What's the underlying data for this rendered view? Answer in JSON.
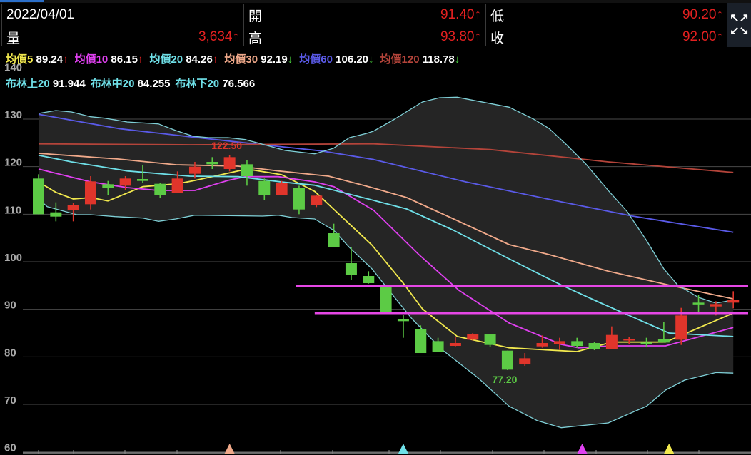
{
  "header": {
    "date": "2022/04/01",
    "open_label": "開",
    "open_value": "91.40↑",
    "low_label": "低",
    "low_value": "90.20↑",
    "volume_label": "量",
    "volume_value": "3,634↑",
    "high_label": "高",
    "high_value": "93.80↑",
    "close_label": "收",
    "close_value": "92.00↑",
    "expand_icon": "expand-arrows-icon"
  },
  "ma_legend": [
    {
      "label": "均價5",
      "value": "89.24",
      "arrow": "↑",
      "color": "#f2e94e",
      "dir": "up"
    },
    {
      "label": "均價10",
      "value": "86.15",
      "arrow": "↑",
      "color": "#e040f0",
      "dir": "up"
    },
    {
      "label": "均價20",
      "value": "84.26",
      "arrow": "↑",
      "color": "#6fe0e8",
      "dir": "up"
    },
    {
      "label": "均價30",
      "value": "92.19",
      "arrow": "↓",
      "color": "#f0a98a",
      "dir": "dn"
    },
    {
      "label": "均價60",
      "value": "106.20",
      "arrow": "↓",
      "color": "#5a5ae8",
      "dir": "dn"
    },
    {
      "label": "均價120",
      "value": "118.78",
      "arrow": "↓",
      "color": "#b4443a",
      "dir": "dn"
    }
  ],
  "boll_legend": [
    {
      "label": "布林上20",
      "value": "91.944"
    },
    {
      "label": "布林中20",
      "value": "84.255"
    },
    {
      "label": "布林下20",
      "value": "76.566"
    }
  ],
  "chart_data": {
    "type": "candlestick",
    "y_ticks": [
      "140",
      "130",
      "120",
      "110",
      "100",
      "90",
      "80",
      "70",
      "60"
    ],
    "ylim": [
      60,
      140
    ],
    "grid": true,
    "colors": {
      "up": "#e0352b",
      "down": "#5ccb45",
      "band_fill": "#252525",
      "band_line": "#7fcfd6",
      "support": "#e647e6"
    },
    "candles": [
      [
        117.5,
        118.4,
        110.0,
        110.0
      ],
      [
        110.4,
        112.5,
        108.5,
        109.5
      ],
      [
        110.9,
        112.3,
        108.5,
        111.9
      ],
      [
        112.1,
        118.0,
        111.0,
        116.9
      ],
      [
        116.3,
        117.0,
        114.0,
        115.5
      ],
      [
        116.0,
        118.0,
        115.0,
        117.5
      ],
      [
        117.4,
        120.4,
        116.5,
        117.0
      ],
      [
        116.4,
        116.6,
        113.5,
        114.0
      ],
      [
        114.5,
        119.0,
        114.5,
        117.5
      ],
      [
        118.5,
        121.0,
        117.5,
        120.0
      ],
      [
        121.0,
        122.0,
        119.5,
        120.5
      ],
      [
        119.5,
        122.5,
        119.0,
        122.0
      ],
      [
        120.5,
        121.4,
        116.0,
        118.0
      ],
      [
        117.0,
        117.5,
        113.0,
        114.0
      ],
      [
        114.0,
        117.0,
        114.0,
        116.5
      ],
      [
        115.5,
        116.0,
        110.0,
        111.0
      ],
      [
        112.0,
        114.0,
        111.5,
        113.9
      ],
      [
        106.0,
        108.0,
        103.0,
        103.0
      ],
      [
        99.7,
        103.0,
        96.2,
        97.2
      ],
      [
        97.0,
        98.0,
        95.4,
        95.5
      ],
      [
        94.6,
        94.8,
        89.3,
        89.3
      ],
      [
        88.0,
        88.8,
        84.0,
        87.5
      ],
      [
        85.8,
        86.6,
        80.8,
        80.8
      ],
      [
        83.3,
        84.0,
        81.0,
        81.1
      ],
      [
        82.3,
        84.1,
        82.2,
        82.9
      ],
      [
        83.6,
        85.0,
        83.4,
        84.7
      ],
      [
        84.7,
        84.7,
        82.0,
        82.5
      ],
      [
        81.3,
        81.3,
        77.2,
        77.3
      ],
      [
        78.4,
        80.8,
        78.1,
        79.7
      ],
      [
        82.2,
        84.5,
        81.9,
        82.9
      ],
      [
        82.6,
        84.0,
        81.5,
        83.3
      ],
      [
        83.3,
        84.0,
        81.9,
        82.3
      ],
      [
        82.9,
        83.2,
        81.4,
        81.6
      ],
      [
        81.7,
        86.4,
        81.6,
        84.6
      ],
      [
        83.5,
        84.1,
        82.6,
        83.8
      ],
      [
        83.0,
        84.0,
        82.0,
        82.7
      ],
      [
        83.7,
        87.3,
        83.0,
        83.0
      ],
      [
        83.6,
        90.3,
        82.5,
        88.7
      ],
      [
        91.4,
        93.0,
        89.3,
        91.1
      ],
      [
        90.6,
        91.7,
        88.7,
        91.1
      ],
      [
        91.4,
        93.8,
        90.2,
        92.0
      ]
    ],
    "candle_fields": [
      "open",
      "high",
      "low",
      "close"
    ],
    "annotations": [
      {
        "text": "122.50",
        "index": 11,
        "value": 122.5,
        "kind": "high"
      },
      {
        "text": "77.20",
        "index": 27,
        "value": 77.2,
        "kind": "low"
      }
    ],
    "support_lines": [
      {
        "value": 94.9,
        "from_index": 14.8
      },
      {
        "value": 89.2,
        "from_index": 15.9
      }
    ],
    "markers": [
      {
        "index": 11,
        "color": "#f0a98a"
      },
      {
        "index": 21,
        "color": "#6fe0e8"
      },
      {
        "index": 31.3,
        "color": "#e040f0"
      },
      {
        "index": 36.3,
        "color": "#f2e94e"
      }
    ],
    "lines": {
      "ma5": [
        [
          0,
          116.8
        ],
        [
          1,
          114.6
        ],
        [
          2,
          113.2
        ],
        [
          3,
          113.5
        ],
        [
          4,
          112.8
        ],
        [
          6,
          115.8
        ],
        [
          8,
          116.4
        ],
        [
          9,
          117.1
        ],
        [
          12,
          119.5
        ],
        [
          14,
          118.3
        ],
        [
          15.9,
          114.8
        ],
        [
          19.2,
          103.5
        ],
        [
          21,
          95.5
        ],
        [
          22.1,
          90.1
        ],
        [
          24.1,
          84.3
        ],
        [
          27.1,
          81.9
        ],
        [
          31,
          81.1
        ],
        [
          33,
          83.1
        ],
        [
          36.1,
          83.1
        ],
        [
          40,
          89.2
        ]
      ],
      "ma10": [
        [
          0,
          119.5
        ],
        [
          3,
          116.8
        ],
        [
          5.1,
          115.6
        ],
        [
          6.9,
          115
        ],
        [
          9,
          115
        ],
        [
          10.9,
          117.1
        ],
        [
          11.9,
          117.9
        ],
        [
          13.8,
          117.9
        ],
        [
          15.9,
          116.8
        ],
        [
          17,
          115.8
        ],
        [
          19.3,
          110.8
        ],
        [
          21.9,
          101.5
        ],
        [
          24.2,
          94
        ],
        [
          27.1,
          87.1
        ],
        [
          30.1,
          82.6
        ],
        [
          31.1,
          81.9
        ],
        [
          33,
          82.3
        ],
        [
          36.1,
          82.3
        ],
        [
          40,
          86.15
        ]
      ],
      "ma20": [
        [
          0,
          122.4
        ],
        [
          1.9,
          121
        ],
        [
          5.1,
          119.1
        ],
        [
          8.7,
          118
        ],
        [
          11.5,
          117.9
        ],
        [
          14.2,
          116.7
        ],
        [
          15.9,
          116.1
        ],
        [
          19.3,
          112.9
        ],
        [
          21.2,
          111.1
        ],
        [
          23.9,
          106.6
        ],
        [
          27.1,
          100.6
        ],
        [
          30.1,
          95.1
        ],
        [
          32.2,
          91.6
        ],
        [
          36.3,
          85
        ],
        [
          40,
          84.26
        ]
      ],
      "ma30": [
        [
          0,
          122.8
        ],
        [
          4.6,
          121.6
        ],
        [
          7.9,
          120.4
        ],
        [
          11.5,
          120.1
        ],
        [
          13.8,
          119.1
        ],
        [
          16.7,
          118
        ],
        [
          19.3,
          115.5
        ],
        [
          21.2,
          113.5
        ],
        [
          23.9,
          109
        ],
        [
          27.1,
          103.6
        ],
        [
          29.4,
          101.5
        ],
        [
          32.8,
          98
        ],
        [
          36.3,
          95.1
        ],
        [
          40,
          92.19
        ]
      ],
      "ma60": [
        [
          0,
          131
        ],
        [
          4.6,
          128
        ],
        [
          8.7,
          126.3
        ],
        [
          12.9,
          124.6
        ],
        [
          16.3,
          123.3
        ],
        [
          19.3,
          121.5
        ],
        [
          24.6,
          116.8
        ],
        [
          30.1,
          112.6
        ],
        [
          34.2,
          109.6
        ],
        [
          40,
          106.2
        ]
      ],
      "ma120": [
        [
          0,
          124.8
        ],
        [
          8.7,
          124.6
        ],
        [
          19.3,
          124.8
        ],
        [
          26,
          123.6
        ],
        [
          32.8,
          121
        ],
        [
          40,
          118.78
        ]
      ],
      "boll_upper": [
        [
          0,
          131.2
        ],
        [
          1,
          131.8
        ],
        [
          1.9,
          131.5
        ],
        [
          3,
          130.5
        ],
        [
          3.8,
          130.2
        ],
        [
          5.1,
          129.4
        ],
        [
          6.9,
          129
        ],
        [
          7.9,
          127.6
        ],
        [
          8.9,
          126.4
        ],
        [
          9.8,
          126.1
        ],
        [
          10.9,
          126.1
        ],
        [
          11.9,
          125.7
        ],
        [
          12.6,
          125
        ],
        [
          14.2,
          123.4
        ],
        [
          15.9,
          122.7
        ],
        [
          17,
          123.9
        ],
        [
          17.9,
          126.1
        ],
        [
          18.9,
          127
        ],
        [
          19.3,
          127.5
        ],
        [
          20.5,
          130
        ],
        [
          22.1,
          133.6
        ],
        [
          23.1,
          134.5
        ],
        [
          24.1,
          134.6
        ],
        [
          27.1,
          132.5
        ],
        [
          28.5,
          130
        ],
        [
          29.4,
          128
        ],
        [
          30.4,
          124.6
        ],
        [
          31.5,
          120.6
        ],
        [
          32.8,
          115
        ],
        [
          33.9,
          110.5
        ],
        [
          35,
          104.5
        ],
        [
          36,
          98.5
        ],
        [
          36.8,
          95.1
        ],
        [
          38,
          92.5
        ],
        [
          39,
          91.3
        ],
        [
          40,
          91.944
        ]
      ],
      "boll_lower": [
        [
          0,
          113.2
        ],
        [
          0.5,
          111.6
        ],
        [
          2.2,
          109.9
        ],
        [
          3,
          109.9
        ],
        [
          4.4,
          109.5
        ],
        [
          6,
          109.2
        ],
        [
          6.9,
          108.5
        ],
        [
          7.9,
          109
        ],
        [
          9,
          109.8
        ],
        [
          12.9,
          109.6
        ],
        [
          13.8,
          109.8
        ],
        [
          14.6,
          109.3
        ],
        [
          15.9,
          109
        ],
        [
          17,
          106.6
        ],
        [
          17.9,
          103
        ],
        [
          19.2,
          98.5
        ],
        [
          20.5,
          92.5
        ],
        [
          21.5,
          88
        ],
        [
          23.2,
          81.6
        ],
        [
          25.3,
          75.6
        ],
        [
          27.1,
          69.6
        ],
        [
          28.7,
          66.6
        ],
        [
          30.1,
          65.1
        ],
        [
          32.8,
          66.1
        ],
        [
          35,
          69.6
        ],
        [
          36.1,
          73
        ],
        [
          37.2,
          75.1
        ],
        [
          39,
          76.7
        ],
        [
          40,
          76.566
        ]
      ]
    },
    "line_colors": {
      "ma5": "#f2e94e",
      "ma10": "#e040f0",
      "ma20": "#6fe0e8",
      "ma30": "#f0a98a",
      "ma60": "#5a5ae8",
      "ma120": "#b4443a",
      "boll_upper": "#7fcfd6",
      "boll_lower": "#7fcfd6"
    }
  }
}
